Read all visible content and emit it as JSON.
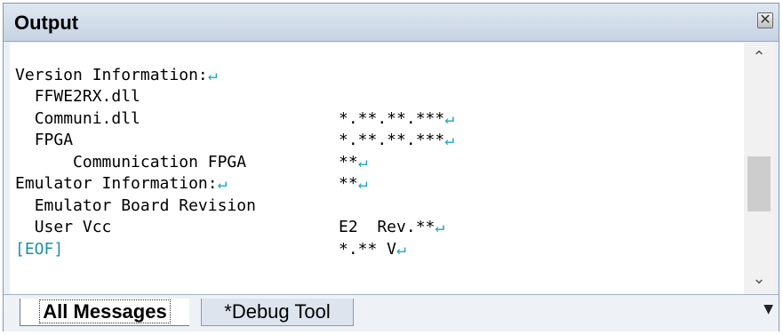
{
  "panel": {
    "title": "Output",
    "close_glyph": "✕"
  },
  "output_lines": [
    {
      "text": "Version Information:",
      "value": "",
      "indent": 0
    },
    {
      "text": "FFWE2RX.dll",
      "value": "*.**.**.***",
      "indent": 1
    },
    {
      "text": "Communi.dll",
      "value": "*.**.**.***",
      "indent": 1
    },
    {
      "text": "FPGA",
      "value": "**",
      "indent": 1
    },
    {
      "text": "Communication FPGA",
      "value": "**",
      "indent": 3
    },
    {
      "text": "Emulator Information:",
      "value": "",
      "indent": 0
    },
    {
      "text": "Emulator Board Revision",
      "value": "E2  Rev.**",
      "indent": 1
    },
    {
      "text": "User Vcc",
      "value": "*.** V",
      "indent": 1
    }
  ],
  "return_mark": "↵",
  "eof_label": "[EOF]",
  "scrollbar": {
    "up_glyph": "⌃",
    "down_glyph": "⌄"
  },
  "tabs": {
    "all_messages": "All Messages",
    "debug_tool": "*Debug Tool",
    "dropdown_glyph": "▼"
  }
}
